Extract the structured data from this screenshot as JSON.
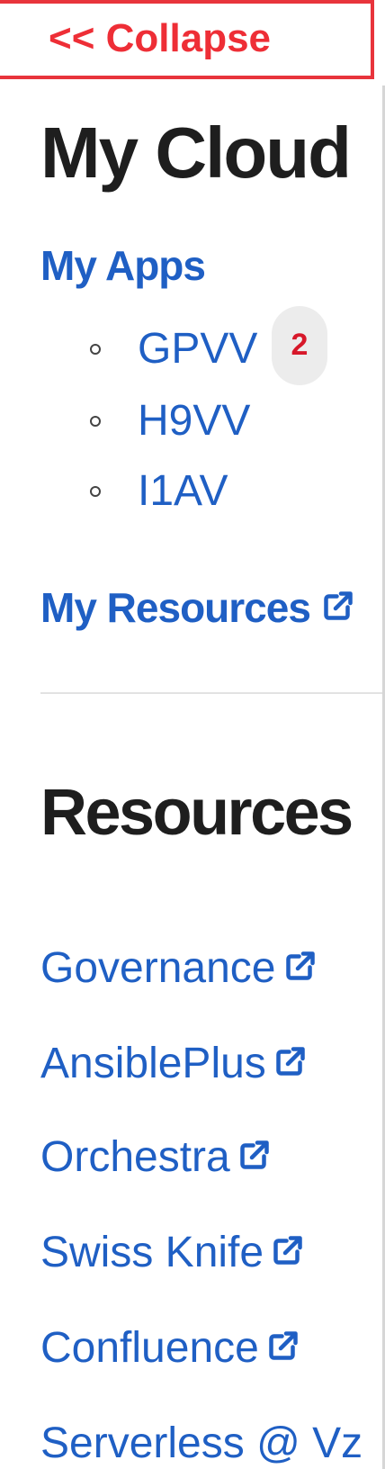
{
  "collapse_label": "<< Collapse",
  "my_cloud": {
    "title": "My Cloud",
    "my_apps_label": "My Apps",
    "apps": [
      {
        "label": "GPVV",
        "badge": "2"
      },
      {
        "label": "H9VV"
      },
      {
        "label": "I1AV"
      }
    ],
    "my_resources_label": "My Resources"
  },
  "resources": {
    "title": "Resources",
    "links": [
      {
        "label": "Governance"
      },
      {
        "label": "AnsiblePlus"
      },
      {
        "label": "Orchestra"
      },
      {
        "label": "Swiss Knife"
      },
      {
        "label": "Confluence"
      },
      {
        "label": "Serverless @ Vz"
      }
    ]
  },
  "colors": {
    "link": "#1f5fc4",
    "collapse_accent": "#ee2e36",
    "badge_text": "#d7182a"
  },
  "icons": {
    "external_link": "external-link-icon"
  }
}
